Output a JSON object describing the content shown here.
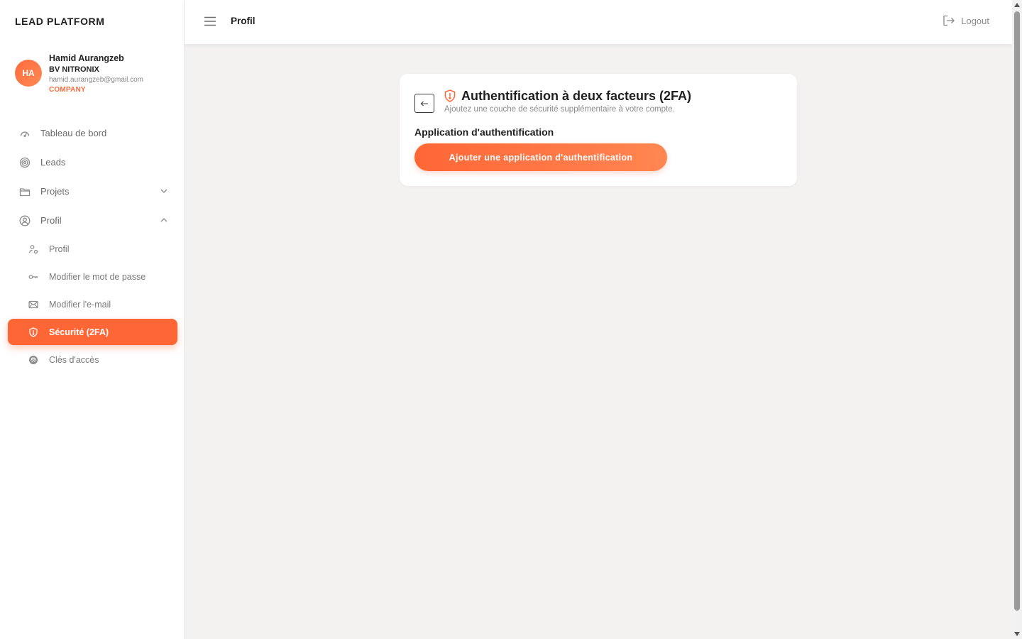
{
  "brand": "LEAD PLATFORM",
  "user": {
    "initials": "HA",
    "name": "Hamid Aurangzeb",
    "company": "BV NITRONIX",
    "email": "hamid.aurangzeb@gmail.com",
    "role": "COMPANY"
  },
  "nav": {
    "dashboard": "Tableau de bord",
    "leads": "Leads",
    "projects": "Projets",
    "profile": "Profil",
    "sub": {
      "profile": "Profil",
      "change_password": "Modifier le mot de passe",
      "change_email": "Modifier l'e-mail",
      "security": "Sécurité (2FA)",
      "access_keys": "Clés d'accès"
    }
  },
  "header": {
    "title": "Profil",
    "logout": "Logout"
  },
  "card": {
    "title": "Authentification à deux facteurs (2FA)",
    "subtitle": "Ajoutez une couche de sécurité supplémentaire à votre compte.",
    "section_label": "Application d'authentification",
    "button_label": "Ajouter une application d'authentification"
  },
  "colors": {
    "accent": "#ff6636",
    "background": "#f3f2f0"
  }
}
